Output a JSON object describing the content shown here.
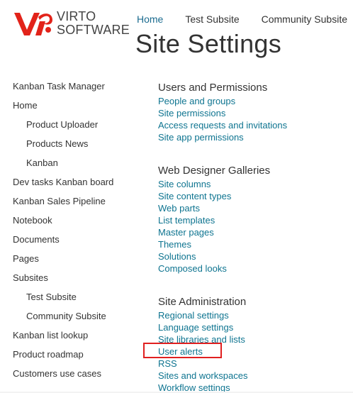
{
  "logo": {
    "line1": "VIRTO",
    "line2": "SOFTWARE",
    "brand_color": "#e2231a"
  },
  "top_nav": [
    {
      "label": "Home",
      "active": true
    },
    {
      "label": "Test Subsite",
      "active": false
    },
    {
      "label": "Community Subsite",
      "active": false
    }
  ],
  "page_title": "Site Settings",
  "left_nav": [
    {
      "label": "Kanban Task Manager",
      "level": 0
    },
    {
      "label": "Home",
      "level": 0
    },
    {
      "label": "Product Uploader",
      "level": 1
    },
    {
      "label": "Products News",
      "level": 1
    },
    {
      "label": "Kanban",
      "level": 1
    },
    {
      "label": "Dev tasks Kanban board",
      "level": 0
    },
    {
      "label": "Kanban Sales Pipeline",
      "level": 0
    },
    {
      "label": "Notebook",
      "level": 0
    },
    {
      "label": "Documents",
      "level": 0
    },
    {
      "label": "Pages",
      "level": 0
    },
    {
      "label": "Subsites",
      "level": 0
    },
    {
      "label": "Test Subsite",
      "level": 1
    },
    {
      "label": "Community Subsite",
      "level": 1
    },
    {
      "label": "Kanban list lookup",
      "level": 0
    },
    {
      "label": "Product roadmap",
      "level": 0
    },
    {
      "label": "Customers use cases",
      "level": 0
    }
  ],
  "sections": [
    {
      "header": "Users and Permissions",
      "links": [
        "People and groups",
        "Site permissions",
        "Access requests and invitations",
        "Site app permissions"
      ]
    },
    {
      "header": "Web Designer Galleries",
      "links": [
        "Site columns",
        "Site content types",
        "Web parts",
        "List templates",
        "Master pages",
        "Themes",
        "Solutions",
        "Composed looks"
      ]
    },
    {
      "header": "Site Administration",
      "links": [
        "Regional settings",
        "Language settings",
        "Site libraries and lists",
        "User alerts",
        "RSS",
        "Sites and workspaces",
        "Workflow settings"
      ]
    }
  ],
  "highlighted_link": "User alerts",
  "colors": {
    "link": "#0e7490",
    "active_tab": "#1b6b8f",
    "text": "#333333",
    "highlight_border": "#e02020"
  }
}
